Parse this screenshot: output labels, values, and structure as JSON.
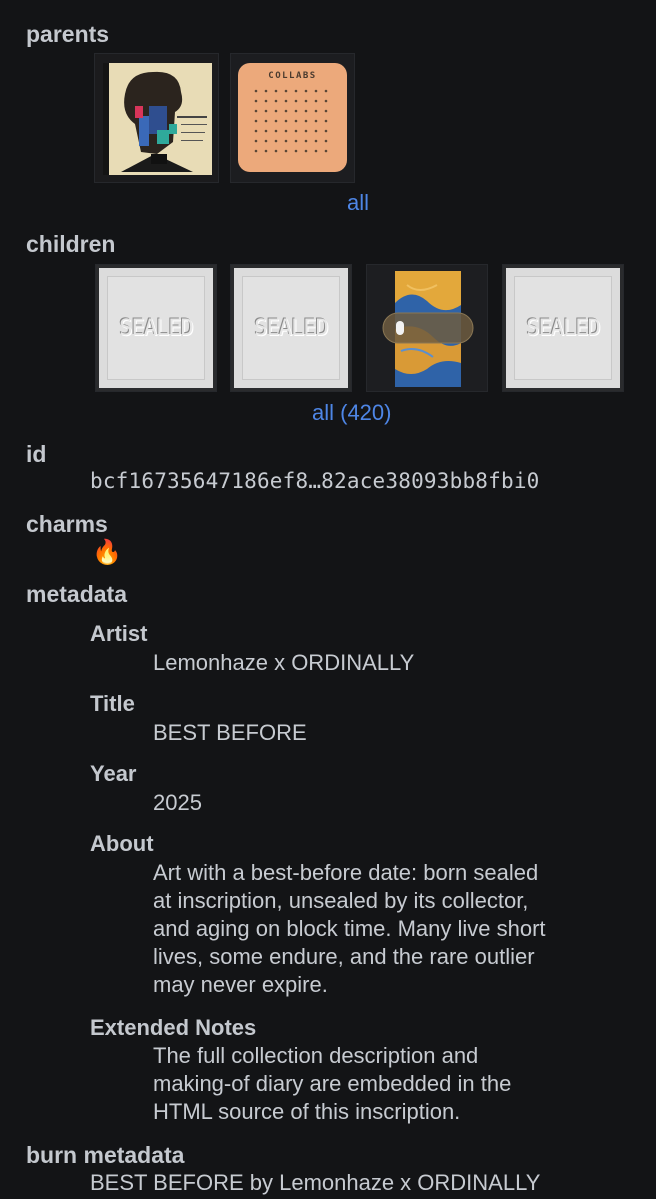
{
  "parents": {
    "heading": "parents",
    "collab_label": "COLLABS",
    "all_link": "all"
  },
  "children": {
    "heading": "children",
    "sealed_label": "SEALED",
    "all_link": "all (420)"
  },
  "id": {
    "heading": "id",
    "value": "bcf16735647186ef8…82ace38093bb8fbi0"
  },
  "charms": {
    "heading": "charms",
    "icon": "🔥"
  },
  "metadata": {
    "heading": "metadata",
    "artist_label": "Artist",
    "artist_value": "Lemonhaze x ORDINALLY",
    "title_label": "Title",
    "title_value": "BEST BEFORE",
    "year_label": "Year",
    "year_value": "2025",
    "about_label": "About",
    "about_lines": [
      "Art with a best-before date: born sealed",
      "at inscription, unsealed by its collector,",
      "and aging on block time. Many live short",
      "lives, some endure, and the rare outlier",
      "may never expire."
    ],
    "notes_label": "Extended Notes",
    "notes_lines": [
      "The full collection description and",
      "making-of diary are embedded in the",
      "HTML source of this inscription."
    ]
  },
  "burn_metadata": {
    "heading": "burn metadata",
    "value": "BEST BEFORE by Lemonhaze x ORDINALLY"
  },
  "colors": {
    "background": "#131416",
    "link": "#4e86e6",
    "text": "#c7cbd1"
  }
}
